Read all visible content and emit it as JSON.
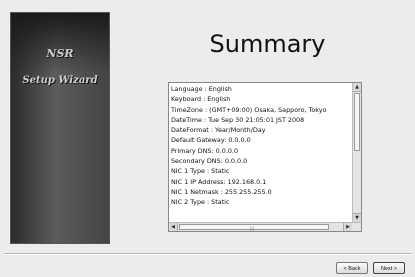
{
  "sidebar": {
    "title": "NSR",
    "subtitle": "Setup Wizard"
  },
  "main": {
    "title": "Summary",
    "summary_lines": [
      "Language : English",
      "Keyboard : English",
      "TimeZone : (GMT+09:00) Osaka, Sapporo, Tokyo",
      "DateTime : Tue Sep 30 21:05:01 JST 2008",
      "DateFormat : Year/Month/Day",
      "Default Gateway: 0.0.0.0",
      "Primary DNS: 0.0.0.0",
      "Secondary DNS: 0.0.0.0",
      "NIC 1 Type : Static",
      "NIC 1 IP Address: 192.168.0.1",
      "NIC 1 Netmask : 255.255.255.0",
      "NIC 2 Type : Static"
    ]
  },
  "footer": {
    "back_label": "< Back",
    "next_label": "Next >"
  },
  "icons": {
    "scroll_up": "scroll-up-arrow-icon",
    "scroll_down": "scroll-down-arrow-icon",
    "scroll_left": "scroll-left-arrow-icon",
    "scroll_right": "scroll-right-arrow-icon"
  }
}
